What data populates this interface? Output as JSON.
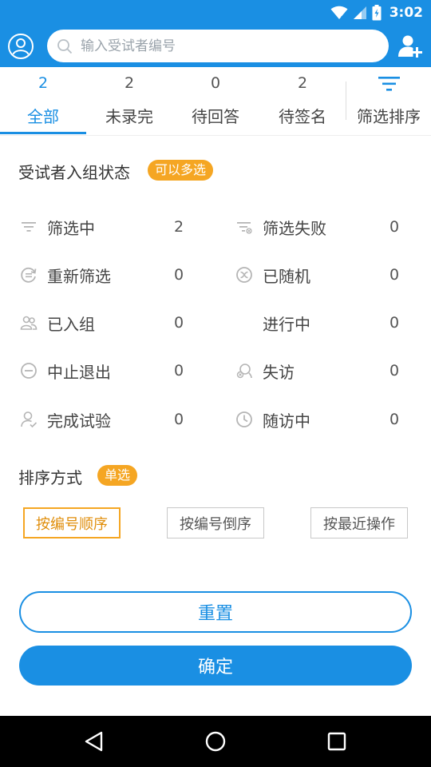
{
  "status_bar": {
    "time": "3:02",
    "icons": [
      "wifi-icon",
      "signal-icon",
      "battery-icon"
    ]
  },
  "header": {
    "search": {
      "value": "",
      "placeholder": "输入受试者编号"
    },
    "left_icon": "user-profile-icon",
    "right_icon": "add-user-icon"
  },
  "tabs": [
    {
      "count": "2",
      "label": "全部",
      "active": true
    },
    {
      "count": "2",
      "label": "未录完",
      "active": false
    },
    {
      "count": "0",
      "label": "待回答",
      "active": false
    },
    {
      "count": "2",
      "label": "待签名",
      "active": false
    }
  ],
  "filter_tab": {
    "label": "筛选排序",
    "icon": "filter-icon"
  },
  "status_section": {
    "title": "受试者入组状态",
    "badge": "可以多选",
    "items": [
      {
        "label": "筛选中",
        "value": "2",
        "icon": "filter-lines-icon"
      },
      {
        "label": "筛选失败",
        "value": "0",
        "icon": "filter-fail-icon"
      },
      {
        "label": "重新筛选",
        "value": "0",
        "icon": "refresh-icon"
      },
      {
        "label": "已随机",
        "value": "0",
        "icon": "shuffle-icon"
      },
      {
        "label": "已入组",
        "value": "0",
        "icon": "group-icon"
      },
      {
        "label": "进行中",
        "value": "0",
        "icon": ""
      },
      {
        "label": "中止退出",
        "value": "0",
        "icon": "stop-icon"
      },
      {
        "label": "失访",
        "value": "0",
        "icon": "lost-visit-icon"
      },
      {
        "label": "完成试验",
        "value": "0",
        "icon": "person-check-icon"
      },
      {
        "label": "随访中",
        "value": "0",
        "icon": "clock-icon"
      }
    ]
  },
  "sort_section": {
    "title": "排序方式",
    "badge": "单选",
    "options": [
      {
        "label": "按编号顺序",
        "selected": true
      },
      {
        "label": "按编号倒序",
        "selected": false
      },
      {
        "label": "按最近操作",
        "selected": false
      }
    ]
  },
  "actions": {
    "reset": "重置",
    "confirm": "确定"
  },
  "nav_bar": {
    "icons": [
      "back-icon",
      "home-icon",
      "recents-icon"
    ]
  },
  "colors": {
    "primary": "#1a8fe3",
    "accent": "#f5a623",
    "text": "#333333",
    "icon_gray": "#b5b5b5"
  }
}
